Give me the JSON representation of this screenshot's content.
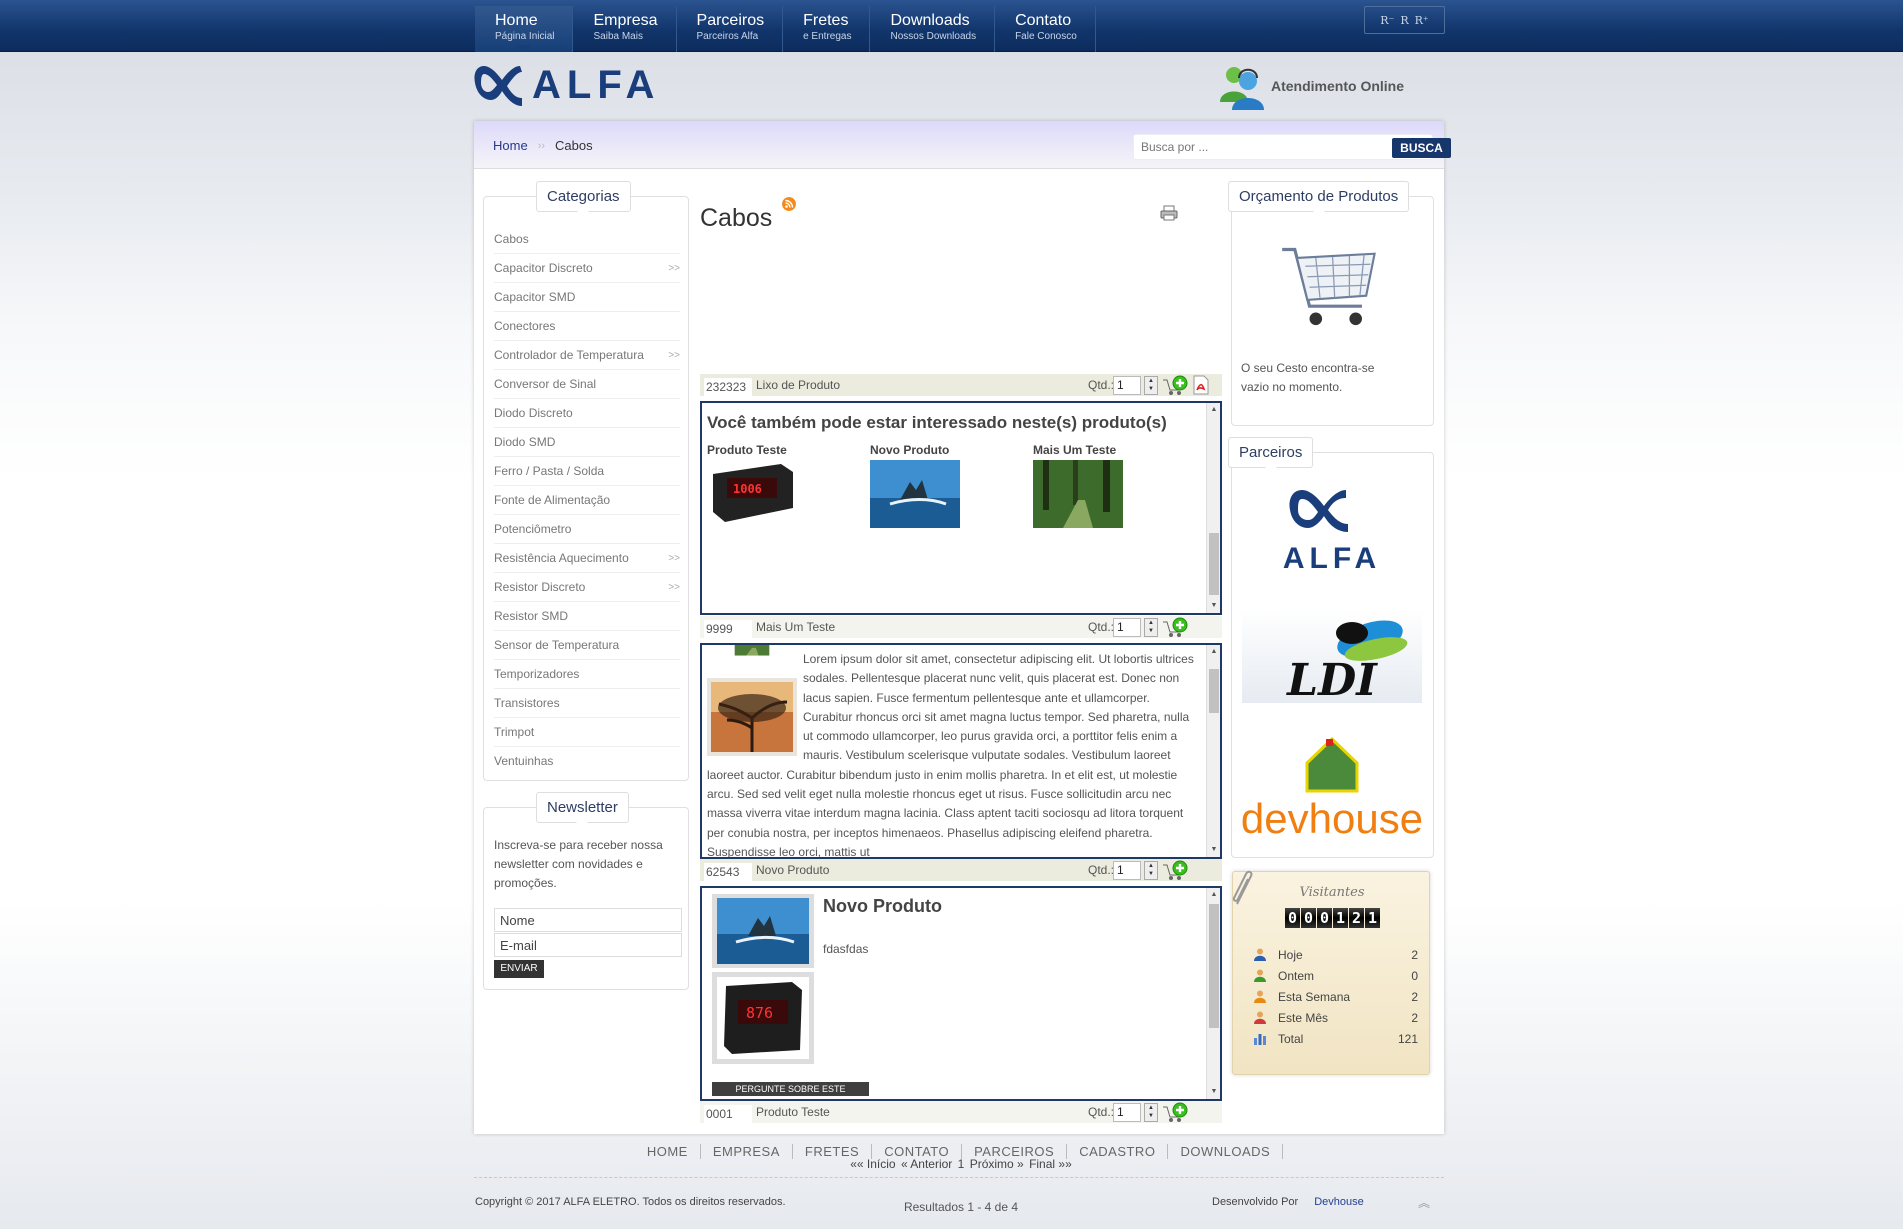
{
  "nav": [
    {
      "main": "Home",
      "sub": "Página Inicial"
    },
    {
      "main": "Empresa",
      "sub": "Saiba Mais"
    },
    {
      "main": "Parceiros",
      "sub": "Parceiros Alfa"
    },
    {
      "main": "Fretes",
      "sub": "e Entregas"
    },
    {
      "main": "Downloads",
      "sub": "Nossos Downloads"
    },
    {
      "main": "Contato",
      "sub": "Fale Conosco"
    }
  ],
  "font_sizer": [
    "R⁻",
    "R",
    "R⁺"
  ],
  "logo_text": "ALFA",
  "online": {
    "label": "Atendimento Online"
  },
  "breadcrumb": {
    "home": "Home",
    "current": "Cabos"
  },
  "search": {
    "placeholder": "Busca por ...",
    "button": "BUSCA"
  },
  "categories": {
    "title": "Categorias",
    "items": [
      {
        "label": "Cabos",
        "arrow": ""
      },
      {
        "label": "Capacitor Discreto",
        "arrow": ">>"
      },
      {
        "label": "Capacitor SMD",
        "arrow": ""
      },
      {
        "label": "Conectores",
        "arrow": ""
      },
      {
        "label": "Controlador de Temperatura",
        "arrow": ">>"
      },
      {
        "label": "Conversor de Sinal",
        "arrow": ""
      },
      {
        "label": "Diodo Discreto",
        "arrow": ""
      },
      {
        "label": "Diodo SMD",
        "arrow": ""
      },
      {
        "label": "Ferro / Pasta / Solda",
        "arrow": ""
      },
      {
        "label": "Fonte de Alimentação",
        "arrow": ""
      },
      {
        "label": "Potenciômetro",
        "arrow": ""
      },
      {
        "label": "Resistência Aquecimento",
        "arrow": ">>"
      },
      {
        "label": "Resistor Discreto",
        "arrow": ">>"
      },
      {
        "label": "Resistor SMD",
        "arrow": ""
      },
      {
        "label": "Sensor de Temperatura",
        "arrow": ""
      },
      {
        "label": "Temporizadores",
        "arrow": ""
      },
      {
        "label": "Transistores",
        "arrow": ""
      },
      {
        "label": "Trimpot",
        "arrow": ""
      },
      {
        "label": "Ventuinhas",
        "arrow": ""
      }
    ]
  },
  "newsletter": {
    "title": "Newsletter",
    "text": "Inscreva-se para receber nossa newsletter com novidades e promoções.",
    "name_value": "Nome",
    "email_value": "E-mail",
    "button": "ENVIAR"
  },
  "main": {
    "title": "Cabos",
    "qtd_label": "Qtd.:",
    "products": [
      {
        "code": "232323",
        "name": "Lixo de Produto",
        "qty": "1"
      },
      {
        "code": "9999",
        "name": "Mais Um Teste",
        "qty": "1"
      },
      {
        "code": "62543",
        "name": "Novo Produto",
        "qty": "1"
      },
      {
        "code": "0001",
        "name": "Produto Teste",
        "qty": "1"
      }
    ],
    "interest": {
      "title": "Você também pode estar interessado neste(s) produto(s)",
      "items": [
        "Produto Teste",
        "Novo Produto",
        "Mais Um Teste"
      ]
    },
    "lorem": "Lorem ipsum dolor sit amet, consectetur adipiscing elit. Ut lobortis ultrices sodales. Pellentesque placerat nunc velit, quis placerat est. Donec non lacus sapien. Fusce fermentum pellentesque ante et ullamcorper. Curabitur rhoncus orci sit amet magna luctus tempor. Sed pharetra, nulla ut commodo ullamcorper, leo purus gravida orci, a porttitor felis enim a mauris. Vestibulum scelerisque vulputate sodales. Vestibulum laoreet laoreet auctor. Curabitur bibendum justo in enim mollis pharetra. In et elit est, ut molestie arcu. Sed sed velit eget nulla molestie rhoncus eget ut risus. Fusce sollicitudin arcu nec massa viverra vitae interdum magna lacinia. Class aptent taciti sociosqu ad litora torquent per conubia nostra, per inceptos himenaeos. Phasellus adipiscing eleifend pharetra. Suspendisse leo orci, mattis ut",
    "novo": {
      "title": "Novo Produto",
      "desc": "fdasfdas",
      "ask": "PERGUNTE SOBRE ESTE PRODUTO"
    },
    "pager": {
      "start": "«« Início",
      "prev": "« Anterior",
      "page": "1",
      "next": "Próximo »",
      "end": "Final »»"
    },
    "results": "Resultados 1 - 4 de 4"
  },
  "cart": {
    "title": "Orçamento de Produtos",
    "text": "O seu Cesto encontra-se vazio no momento."
  },
  "partners": {
    "title": "Parceiros",
    "alfa": "ALFA",
    "ldi": "LDI",
    "devhouse": "devhouse"
  },
  "visitors": {
    "title": "Visitantes",
    "counter": [
      "0",
      "0",
      "0",
      "1",
      "2",
      "1"
    ],
    "rows": [
      {
        "label": "Hoje",
        "value": "2"
      },
      {
        "label": "Ontem",
        "value": "0"
      },
      {
        "label": "Esta Semana",
        "value": "2"
      },
      {
        "label": "Este Mês",
        "value": "2"
      },
      {
        "label": "Total",
        "value": "121"
      }
    ]
  },
  "footer": {
    "links": [
      "HOME",
      "EMPRESA",
      "FRETES",
      "CONTATO",
      "PARCEIROS",
      "CADASTRO",
      "DOWNLOADS"
    ],
    "copyright": "Copyright © 2017 ALFA ELETRO. Todos os direitos reservados.",
    "dev_label": "Desenvolvido Por",
    "dev_link": "Devhouse"
  },
  "colors": {
    "nav_bg": "#11356b",
    "accent": "#1f3966",
    "link": "#26398f"
  }
}
